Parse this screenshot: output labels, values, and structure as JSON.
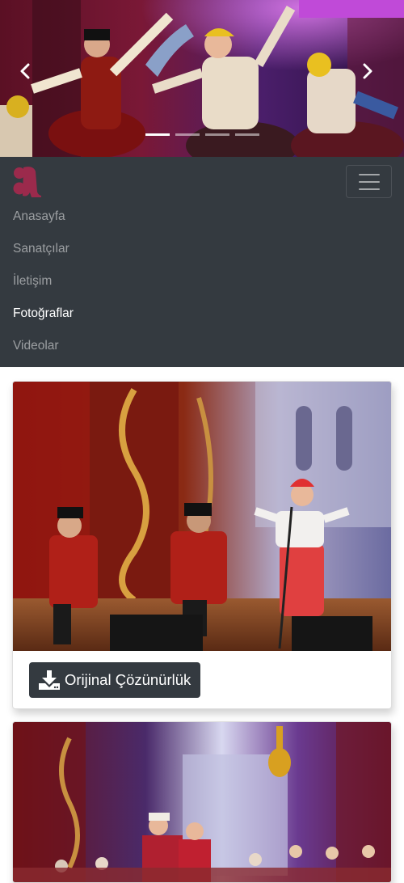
{
  "carousel": {
    "prev_icon": "chevron-left-icon",
    "next_icon": "chevron-right-icon",
    "slide_count": 4,
    "active_slide": 1
  },
  "navbar": {
    "brand_logo": "a-letter-logo",
    "brand_color": "#9b2a4c",
    "toggler_icon": "hamburger-menu-icon",
    "links": [
      {
        "label": "Anasayfa",
        "active": false
      },
      {
        "label": "Sanatçılar",
        "active": false
      },
      {
        "label": "İletişim",
        "active": false
      },
      {
        "label": "Fotoğraflar",
        "active": true
      },
      {
        "label": "Videolar",
        "active": false
      }
    ]
  },
  "gallery": {
    "download_label": "Orijinal Çözünürlük",
    "download_icon": "download-icon"
  },
  "colors": {
    "navbar_bg": "#343a40",
    "button_bg": "#343a40"
  }
}
